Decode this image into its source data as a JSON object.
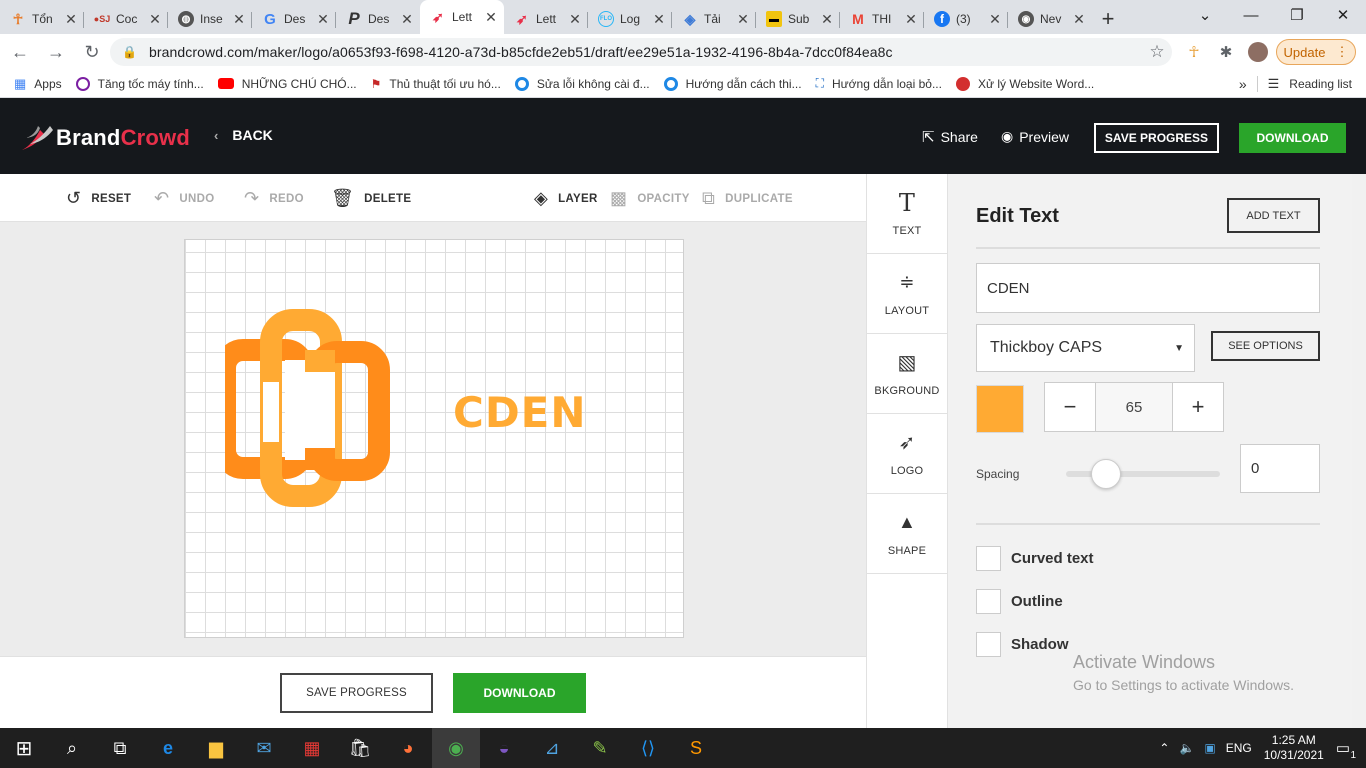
{
  "browser": {
    "tabs": [
      {
        "label": "Tổn",
        "favicon_color": "#e87d2c",
        "favicon_glyph": "person-icon"
      },
      {
        "label": "Coc",
        "favicon_color": "#c0392b",
        "favicon_glyph": "sj-icon"
      },
      {
        "label": "Inse",
        "favicon_color": "#555555",
        "favicon_glyph": "globe-icon"
      },
      {
        "label": "Des",
        "favicon_color": "#4285f4",
        "favicon_glyph": "google-icon"
      },
      {
        "label": "Des",
        "favicon_color": "#333333",
        "favicon_glyph": "p-icon"
      },
      {
        "label": "Lett",
        "favicon_color": "#e8304a",
        "favicon_glyph": "brandcrowd-icon"
      },
      {
        "label": "Lett",
        "favicon_color": "#e8304a",
        "favicon_glyph": "brandcrowd-icon"
      },
      {
        "label": "Log",
        "favicon_color": "#29b6f6",
        "favicon_glyph": "flo-icon"
      },
      {
        "label": "Tải",
        "favicon_color": "#3f7bd6",
        "favicon_glyph": "layers-icon"
      },
      {
        "label": "Sub",
        "favicon_color": "#f1c40f",
        "favicon_glyph": "sub-icon"
      },
      {
        "label": "THI",
        "favicon_color": "#ea4335",
        "favicon_glyph": "gmail-icon"
      },
      {
        "label": "(3)",
        "favicon_color": "#1877f2",
        "favicon_glyph": "facebook-icon"
      },
      {
        "label": "Nev",
        "favicon_color": "#555555",
        "favicon_glyph": "chrome-icon"
      }
    ],
    "active_tab_index": 5,
    "url": "brandcrowd.com/maker/logo/a0653f93-f698-4120-a73d-b85cfde2eb51/draft/ee29e51a-1932-4196-8b4a-7dcc0f84ea8c",
    "update_label": "Update",
    "bookmarks": [
      {
        "label": "Apps",
        "color": "#4285f4"
      },
      {
        "label": "Tăng tốc máy tính...",
        "color": "#7b1fa2"
      },
      {
        "label": "NHỮNG CHÚ CHÓ...",
        "color": "#ff0000"
      },
      {
        "label": "Thủ thuật tối ưu hó...",
        "color": "#c62828"
      },
      {
        "label": "Sửa lỗi không cài đ...",
        "color": "#1e88e5"
      },
      {
        "label": "Hướng dẫn cách thi...",
        "color": "#1e88e5"
      },
      {
        "label": "Hướng dẫn loại bỏ...",
        "color": "#1565c0"
      },
      {
        "label": "Xử lý Website Word...",
        "color": "#d32f2f"
      }
    ],
    "reading_list_label": "Reading list"
  },
  "header": {
    "brand_part1": "Brand",
    "brand_part2": "Crowd",
    "back_label": "BACK",
    "share_label": "Share",
    "preview_label": "Preview",
    "save_progress_label": "SAVE PROGRESS",
    "download_label": "DOWNLOAD"
  },
  "editor_toolbar": {
    "reset": "RESET",
    "undo": "UNDO",
    "redo": "REDO",
    "delete": "DELETE",
    "layer": "LAYER",
    "opacity": "OPACITY",
    "duplicate": "DUPLICATE"
  },
  "canvas": {
    "logo_text": "CDEN",
    "logo_color_light": "#ffaa33",
    "logo_color_dark": "#ff8c1a"
  },
  "bottom_bar": {
    "save_progress_label": "SAVE PROGRESS",
    "download_label": "DOWNLOAD"
  },
  "side_tools": [
    {
      "label": "TEXT",
      "icon": "text-icon"
    },
    {
      "label": "LAYOUT",
      "icon": "layout-icon"
    },
    {
      "label": "BKGROUND",
      "icon": "background-icon"
    },
    {
      "label": "LOGO",
      "icon": "logo-icon"
    },
    {
      "label": "SHAPE",
      "icon": "shape-icon"
    }
  ],
  "edit_panel": {
    "title": "Edit Text",
    "add_text_label": "ADD TEXT",
    "text_value": "CDEN",
    "font_name": "Thickboy CAPS",
    "see_options_label": "SEE OPTIONS",
    "color": "#ffaa33",
    "font_size": "65",
    "spacing_label": "Spacing",
    "spacing_value": "0",
    "curved_text_label": "Curved text",
    "outline_label": "Outline",
    "shadow_label": "Shadow"
  },
  "watermark": {
    "line1": "Activate Windows",
    "line2": "Go to Settings to activate Windows."
  },
  "taskbar": {
    "language": "ENG",
    "time": "1:25 AM",
    "date": "10/31/2021",
    "notification_count": "1"
  }
}
